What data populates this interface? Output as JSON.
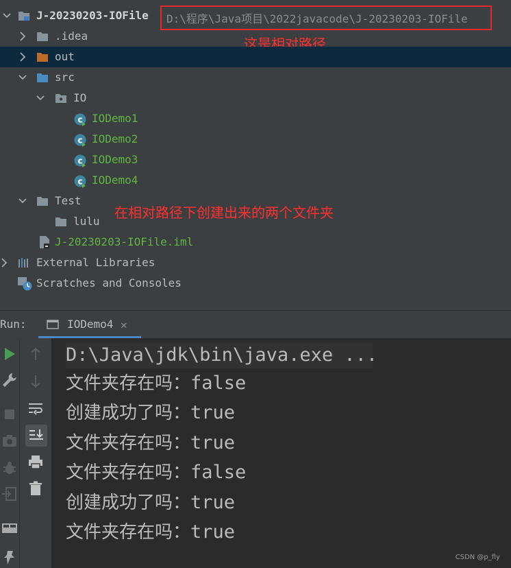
{
  "project_tree": {
    "root": {
      "name": "J-20230203-IOFile",
      "path": "D:\\程序\\Java项目\\2022javacode\\J-20230203-IOFile"
    },
    "items": [
      {
        "label": ".idea"
      },
      {
        "label": "out"
      },
      {
        "label": "src"
      },
      {
        "label": "IO"
      },
      {
        "label": "IODemo1"
      },
      {
        "label": "IODemo2"
      },
      {
        "label": "IODemo3"
      },
      {
        "label": "IODemo4"
      },
      {
        "label": "Test"
      },
      {
        "label": "lulu"
      },
      {
        "label": "J-20230203-IOFile.iml"
      },
      {
        "label": "External Libraries"
      },
      {
        "label": "Scratches and Consoles"
      }
    ]
  },
  "annotations": {
    "relative_path_note": "这是相对路径",
    "folders_note": "在相对路径下创建出来的两个文件夹",
    "highlight_color": "#e8272b"
  },
  "run_panel": {
    "label": "Run:",
    "tab_label": "IODemo4",
    "accent_color": "#4a88c7"
  },
  "console": {
    "command": "D:\\Java\\jdk\\bin\\java.exe ...",
    "lines": [
      {
        "text": "文件夹存在吗：",
        "value": "false"
      },
      {
        "text": "创建成功了吗：",
        "value": "true"
      },
      {
        "text": "文件夹存在吗：",
        "value": "true"
      },
      {
        "text": "文件夹存在吗：",
        "value": "false"
      },
      {
        "text": "创建成功了吗：",
        "value": "true"
      },
      {
        "text": "文件夹存在吗：",
        "value": "true"
      }
    ]
  },
  "watermark": "CSDN @p_fly"
}
